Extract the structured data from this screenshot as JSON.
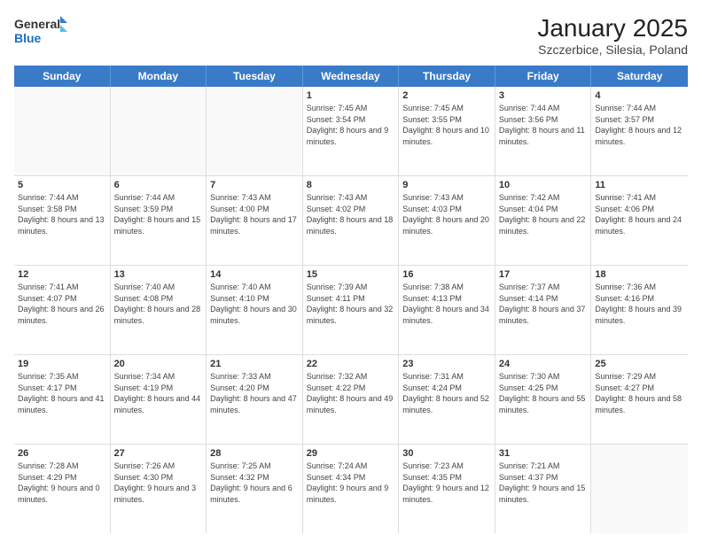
{
  "header": {
    "logo_line1": "General",
    "logo_line2": "Blue",
    "title": "January 2025",
    "subtitle": "Szczerbice, Silesia, Poland"
  },
  "days_of_week": [
    "Sunday",
    "Monday",
    "Tuesday",
    "Wednesday",
    "Thursday",
    "Friday",
    "Saturday"
  ],
  "weeks": [
    [
      {
        "day": "",
        "info": ""
      },
      {
        "day": "",
        "info": ""
      },
      {
        "day": "",
        "info": ""
      },
      {
        "day": "1",
        "info": "Sunrise: 7:45 AM\nSunset: 3:54 PM\nDaylight: 8 hours and 9 minutes."
      },
      {
        "day": "2",
        "info": "Sunrise: 7:45 AM\nSunset: 3:55 PM\nDaylight: 8 hours and 10 minutes."
      },
      {
        "day": "3",
        "info": "Sunrise: 7:44 AM\nSunset: 3:56 PM\nDaylight: 8 hours and 11 minutes."
      },
      {
        "day": "4",
        "info": "Sunrise: 7:44 AM\nSunset: 3:57 PM\nDaylight: 8 hours and 12 minutes."
      }
    ],
    [
      {
        "day": "5",
        "info": "Sunrise: 7:44 AM\nSunset: 3:58 PM\nDaylight: 8 hours and 13 minutes."
      },
      {
        "day": "6",
        "info": "Sunrise: 7:44 AM\nSunset: 3:59 PM\nDaylight: 8 hours and 15 minutes."
      },
      {
        "day": "7",
        "info": "Sunrise: 7:43 AM\nSunset: 4:00 PM\nDaylight: 8 hours and 17 minutes."
      },
      {
        "day": "8",
        "info": "Sunrise: 7:43 AM\nSunset: 4:02 PM\nDaylight: 8 hours and 18 minutes."
      },
      {
        "day": "9",
        "info": "Sunrise: 7:43 AM\nSunset: 4:03 PM\nDaylight: 8 hours and 20 minutes."
      },
      {
        "day": "10",
        "info": "Sunrise: 7:42 AM\nSunset: 4:04 PM\nDaylight: 8 hours and 22 minutes."
      },
      {
        "day": "11",
        "info": "Sunrise: 7:41 AM\nSunset: 4:06 PM\nDaylight: 8 hours and 24 minutes."
      }
    ],
    [
      {
        "day": "12",
        "info": "Sunrise: 7:41 AM\nSunset: 4:07 PM\nDaylight: 8 hours and 26 minutes."
      },
      {
        "day": "13",
        "info": "Sunrise: 7:40 AM\nSunset: 4:08 PM\nDaylight: 8 hours and 28 minutes."
      },
      {
        "day": "14",
        "info": "Sunrise: 7:40 AM\nSunset: 4:10 PM\nDaylight: 8 hours and 30 minutes."
      },
      {
        "day": "15",
        "info": "Sunrise: 7:39 AM\nSunset: 4:11 PM\nDaylight: 8 hours and 32 minutes."
      },
      {
        "day": "16",
        "info": "Sunrise: 7:38 AM\nSunset: 4:13 PM\nDaylight: 8 hours and 34 minutes."
      },
      {
        "day": "17",
        "info": "Sunrise: 7:37 AM\nSunset: 4:14 PM\nDaylight: 8 hours and 37 minutes."
      },
      {
        "day": "18",
        "info": "Sunrise: 7:36 AM\nSunset: 4:16 PM\nDaylight: 8 hours and 39 minutes."
      }
    ],
    [
      {
        "day": "19",
        "info": "Sunrise: 7:35 AM\nSunset: 4:17 PM\nDaylight: 8 hours and 41 minutes."
      },
      {
        "day": "20",
        "info": "Sunrise: 7:34 AM\nSunset: 4:19 PM\nDaylight: 8 hours and 44 minutes."
      },
      {
        "day": "21",
        "info": "Sunrise: 7:33 AM\nSunset: 4:20 PM\nDaylight: 8 hours and 47 minutes."
      },
      {
        "day": "22",
        "info": "Sunrise: 7:32 AM\nSunset: 4:22 PM\nDaylight: 8 hours and 49 minutes."
      },
      {
        "day": "23",
        "info": "Sunrise: 7:31 AM\nSunset: 4:24 PM\nDaylight: 8 hours and 52 minutes."
      },
      {
        "day": "24",
        "info": "Sunrise: 7:30 AM\nSunset: 4:25 PM\nDaylight: 8 hours and 55 minutes."
      },
      {
        "day": "25",
        "info": "Sunrise: 7:29 AM\nSunset: 4:27 PM\nDaylight: 8 hours and 58 minutes."
      }
    ],
    [
      {
        "day": "26",
        "info": "Sunrise: 7:28 AM\nSunset: 4:29 PM\nDaylight: 9 hours and 0 minutes."
      },
      {
        "day": "27",
        "info": "Sunrise: 7:26 AM\nSunset: 4:30 PM\nDaylight: 9 hours and 3 minutes."
      },
      {
        "day": "28",
        "info": "Sunrise: 7:25 AM\nSunset: 4:32 PM\nDaylight: 9 hours and 6 minutes."
      },
      {
        "day": "29",
        "info": "Sunrise: 7:24 AM\nSunset: 4:34 PM\nDaylight: 9 hours and 9 minutes."
      },
      {
        "day": "30",
        "info": "Sunrise: 7:23 AM\nSunset: 4:35 PM\nDaylight: 9 hours and 12 minutes."
      },
      {
        "day": "31",
        "info": "Sunrise: 7:21 AM\nSunset: 4:37 PM\nDaylight: 9 hours and 15 minutes."
      },
      {
        "day": "",
        "info": ""
      }
    ]
  ]
}
